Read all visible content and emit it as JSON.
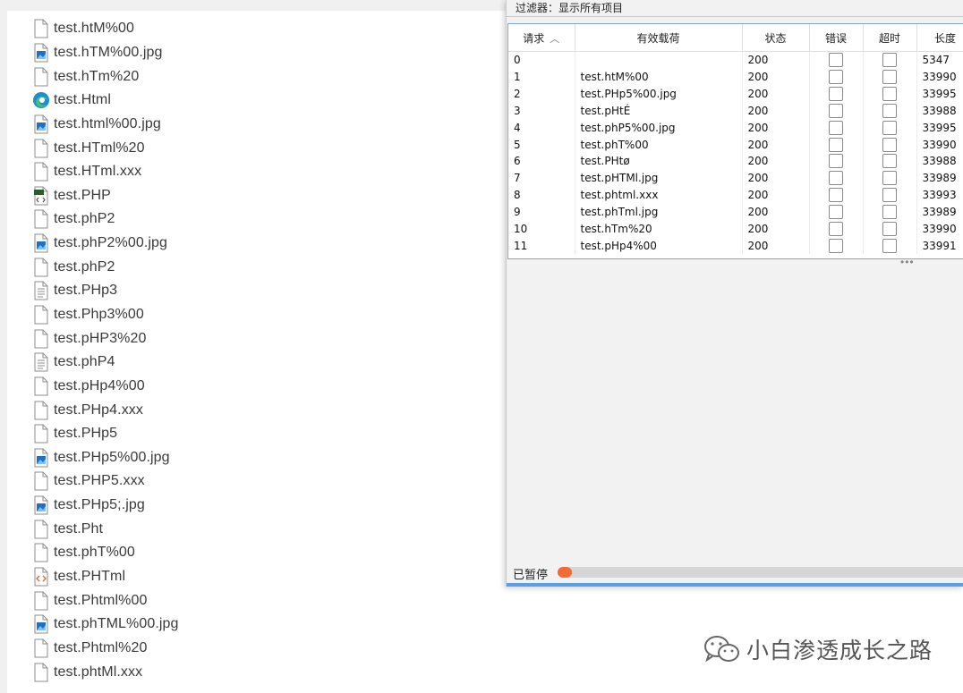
{
  "explorer": {
    "files": [
      {
        "name": "test.htM%00",
        "icon": "blank"
      },
      {
        "name": "test.hTM%00.jpg",
        "icon": "image"
      },
      {
        "name": "test.hTm%20",
        "icon": "blank"
      },
      {
        "name": "test.Html",
        "icon": "edge"
      },
      {
        "name": "test.html%00.jpg",
        "icon": "image"
      },
      {
        "name": "test.HTml%20",
        "icon": "blank"
      },
      {
        "name": "test.HTml.xxx",
        "icon": "blank"
      },
      {
        "name": "test.PHP",
        "icon": "php"
      },
      {
        "name": "test.phP2",
        "icon": "blank"
      },
      {
        "name": "test.phP2%00.jpg",
        "icon": "image"
      },
      {
        "name": "test.phP2",
        "icon": "blank"
      },
      {
        "name": "test.PHp3",
        "icon": "text"
      },
      {
        "name": "test.Php3%00",
        "icon": "blank"
      },
      {
        "name": "test.pHP3%20",
        "icon": "blank"
      },
      {
        "name": "test.phP4",
        "icon": "text"
      },
      {
        "name": "test.pHp4%00",
        "icon": "blank"
      },
      {
        "name": "test.PHp4.xxx",
        "icon": "blank"
      },
      {
        "name": "test.PHp5",
        "icon": "blank"
      },
      {
        "name": "test.PHp5%00.jpg",
        "icon": "image"
      },
      {
        "name": "test.PHP5.xxx",
        "icon": "blank"
      },
      {
        "name": "test.PHp5;.jpg",
        "icon": "image"
      },
      {
        "name": "test.Pht",
        "icon": "blank"
      },
      {
        "name": "test.phT%00",
        "icon": "blank"
      },
      {
        "name": "test.PHTml",
        "icon": "code"
      },
      {
        "name": "test.Phtml%00",
        "icon": "blank"
      },
      {
        "name": "test.phTML%00.jpg",
        "icon": "image"
      },
      {
        "name": "test.Phtml%20",
        "icon": "blank"
      },
      {
        "name": "test.phtMl.xxx",
        "icon": "blank"
      }
    ]
  },
  "results": {
    "filter_label": "过滤器：显示所有项目",
    "columns": [
      "请求",
      "有效载荷",
      "状态",
      "错误",
      "超时",
      "长度"
    ],
    "sort_indicator": "^",
    "rows": [
      {
        "req": "0",
        "payload": "",
        "status": "200",
        "length": "5347"
      },
      {
        "req": "1",
        "payload": "test.htM%00",
        "status": "200",
        "length": "33990"
      },
      {
        "req": "2",
        "payload": "test.PHp5%00.jpg",
        "status": "200",
        "length": "33995"
      },
      {
        "req": "3",
        "payload": "test.pHtÉ",
        "status": "200",
        "length": "33988"
      },
      {
        "req": "4",
        "payload": "test.phP5%00.jpg",
        "status": "200",
        "length": "33995"
      },
      {
        "req": "5",
        "payload": "test.phT%00",
        "status": "200",
        "length": "33990"
      },
      {
        "req": "6",
        "payload": "test.PHtø",
        "status": "200",
        "length": "33988"
      },
      {
        "req": "7",
        "payload": "test.pHTMl.jpg",
        "status": "200",
        "length": "33989"
      },
      {
        "req": "8",
        "payload": "test.phtml.xxx",
        "status": "200",
        "length": "33993"
      },
      {
        "req": "9",
        "payload": "test.phTml.jpg",
        "status": "200",
        "length": "33989"
      },
      {
        "req": "10",
        "payload": "test.hTm%20",
        "status": "200",
        "length": "33990"
      },
      {
        "req": "11",
        "payload": "test.pHp4%00",
        "status": "200",
        "length": "33991"
      }
    ],
    "splitter": "•••",
    "status_text": "已暂停",
    "progress_fraction": 0.03,
    "accent_color": "#f26a35"
  },
  "watermark": {
    "text": "小白渗透成长之路",
    "icon": "wechat-icon"
  }
}
